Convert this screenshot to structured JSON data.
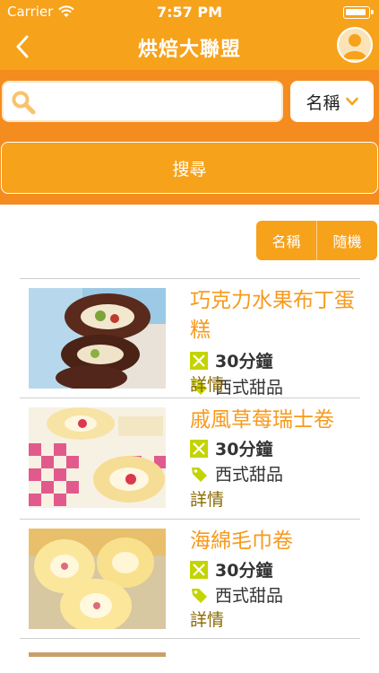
{
  "status_bar": {
    "carrier": "Carrier",
    "time": "7:57 PM"
  },
  "nav": {
    "title": "烘焙大聯盟",
    "back_icon": "chevron-left-icon",
    "avatar_icon": "user-icon"
  },
  "search": {
    "value": "",
    "placeholder": "",
    "select_value": "名稱",
    "button_label": "搜尋"
  },
  "sort": {
    "by_name": "名稱",
    "random": "隨機"
  },
  "colors": {
    "brand": "#f7a21b",
    "search_bg": "#f58c1f",
    "title_text": "#f79a1c",
    "icon_green": "#c3d400"
  },
  "recipes": [
    {
      "title": "巧克力水果布丁蛋糕",
      "time": "30分鐘",
      "category": "西式甜品",
      "detail": "詳情"
    },
    {
      "title": "戚風草莓瑞士卷",
      "time": "30分鐘",
      "category": "西式甜品",
      "detail": "詳情"
    },
    {
      "title": "海綿毛巾卷",
      "time": "30分鐘",
      "category": "西式甜品",
      "detail": "詳情"
    }
  ]
}
